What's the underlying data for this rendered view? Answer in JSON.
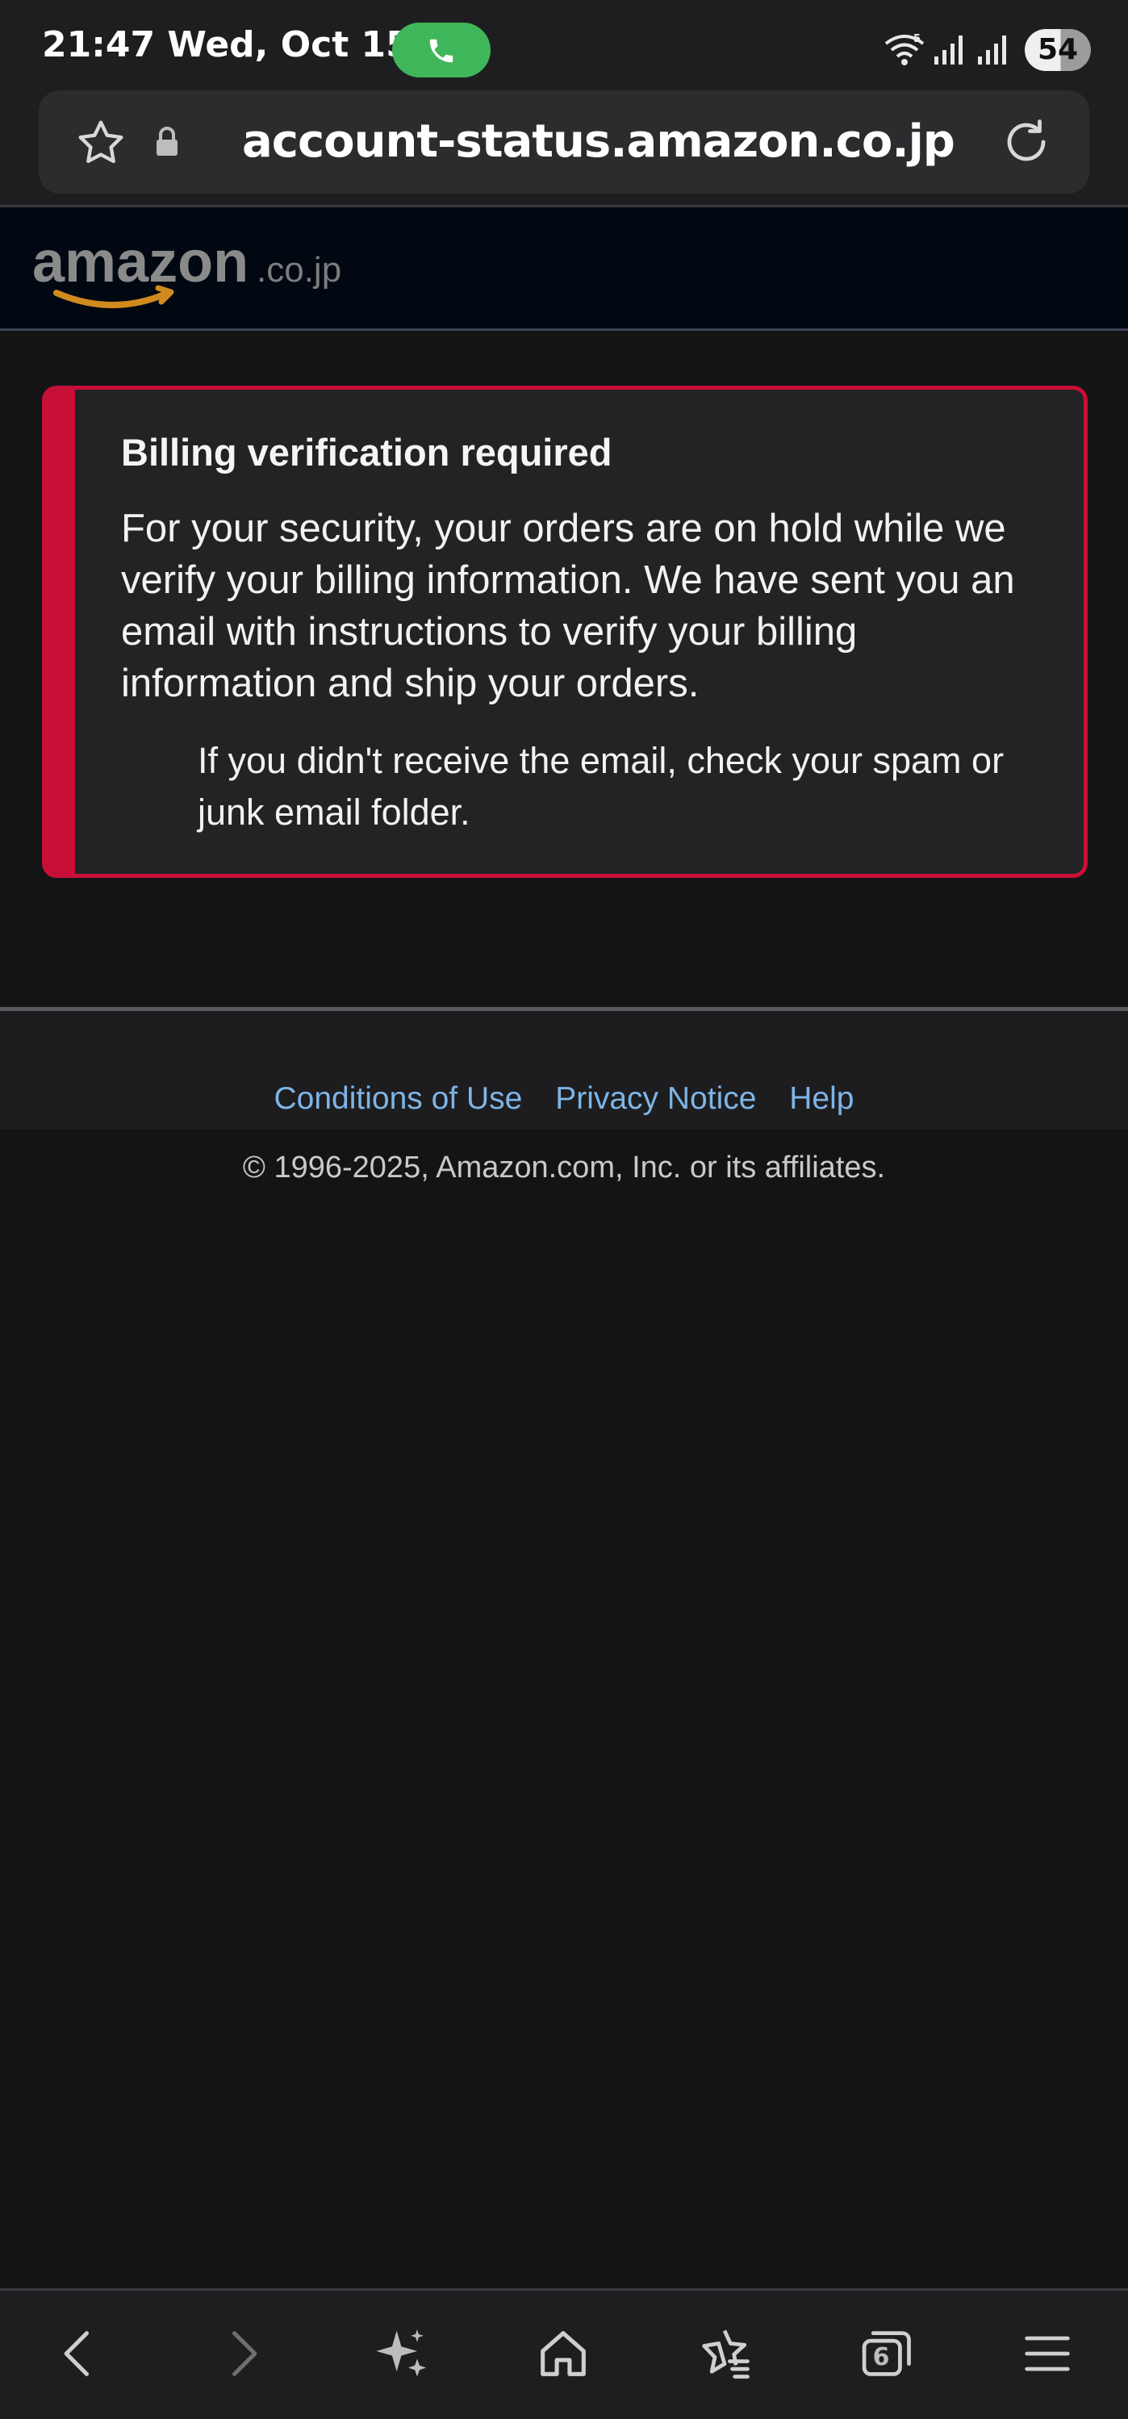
{
  "status_bar": {
    "time_date": "21:47 Wed, Oct 15",
    "battery": "54",
    "icons": [
      "phone-call-icon",
      "wifi-icon",
      "signal-icon",
      "signal-icon"
    ]
  },
  "url_bar": {
    "url": "account-status.amazon.co.jp",
    "icons": [
      "star-icon",
      "lock-icon",
      "reload-icon"
    ]
  },
  "header": {
    "logo_text": "amazon",
    "logo_suffix": ".co.jp"
  },
  "alert": {
    "title": "Billing verification required",
    "body": "For your security, your orders are on hold while we verify your billing information. We have sent you an email with instructions to verify your billing information and ship your orders.",
    "note": "If you didn't receive the email, check your spam or junk email folder.",
    "accent_color": "#c70f38"
  },
  "footer": {
    "links": [
      "Conditions of Use",
      "Privacy Notice",
      "Help"
    ],
    "copyright": "© 1996-2025, Amazon.com, Inc. or its affiliates.",
    "link_color": "#7fb4e6"
  },
  "bottom_nav": {
    "tab_count": "6",
    "icons": [
      "back-icon",
      "forward-icon",
      "ai-sparkle-icon",
      "home-icon",
      "bookmarks-icon",
      "tabs-icon",
      "menu-icon"
    ]
  }
}
